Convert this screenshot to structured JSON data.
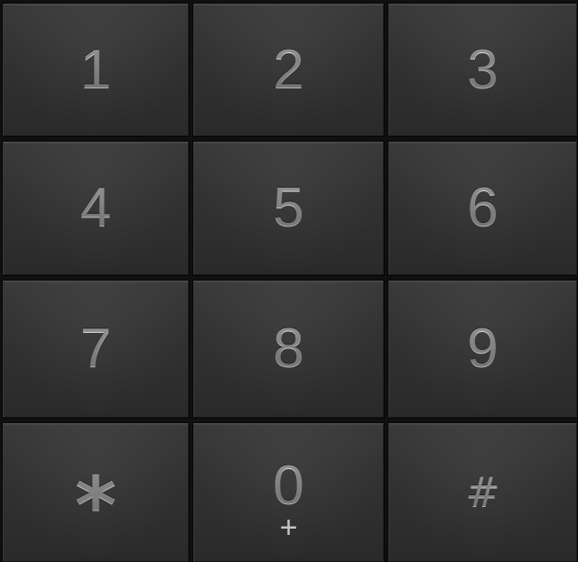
{
  "keypad": {
    "keys": [
      {
        "label": "1",
        "sub": ""
      },
      {
        "label": "2",
        "sub": ""
      },
      {
        "label": "3",
        "sub": ""
      },
      {
        "label": "4",
        "sub": ""
      },
      {
        "label": "5",
        "sub": ""
      },
      {
        "label": "6",
        "sub": ""
      },
      {
        "label": "7",
        "sub": ""
      },
      {
        "label": "8",
        "sub": ""
      },
      {
        "label": "9",
        "sub": ""
      },
      {
        "label": "*",
        "sub": ""
      },
      {
        "label": "0",
        "sub": "+"
      },
      {
        "label": "#",
        "sub": ""
      }
    ],
    "colors": {
      "key_face": "#323232",
      "digit": "#c8c8c8",
      "divider": "#101010"
    }
  }
}
